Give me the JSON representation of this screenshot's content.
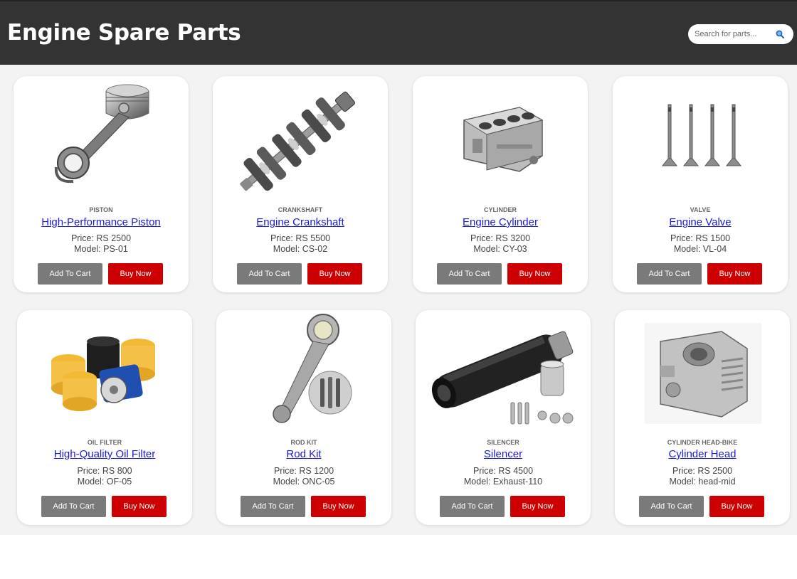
{
  "header": {
    "title": "Engine Spare Parts",
    "search_placeholder": "Search for parts..."
  },
  "products": [
    {
      "category": "PISTON",
      "name": "High-Performance Piston",
      "price": "Price: RS 2500",
      "model": "Model: PS-01",
      "add_label": "Add To Cart",
      "buy_label": "Buy Now",
      "icon": "piston-image"
    },
    {
      "category": "CRANKSHAFT",
      "name": "Engine Crankshaft",
      "price": "Price: RS 5500",
      "model": "Model: CS-02",
      "add_label": "Add To Cart",
      "buy_label": "Buy Now",
      "icon": "crankshaft-image"
    },
    {
      "category": "CYLINDER",
      "name": "Engine Cylinder",
      "price": "Price: RS 3200",
      "model": "Model: CY-03",
      "add_label": "Add To Cart",
      "buy_label": "Buy Now",
      "icon": "cylinder-image"
    },
    {
      "category": "VALVE",
      "name": "Engine Valve",
      "price": "Price: RS 1500",
      "model": "Model: VL-04",
      "add_label": "Add To Cart",
      "buy_label": "Buy Now",
      "icon": "valve-image"
    },
    {
      "category": "OIL FILTER",
      "name": "High-Quality Oil Filter",
      "price": "Price: RS 800",
      "model": "Model: OF-05",
      "add_label": "Add To Cart",
      "buy_label": "Buy Now",
      "icon": "oil-filter-image"
    },
    {
      "category": "ROD KIT",
      "name": "Rod Kit",
      "price": "Price: RS 1200",
      "model": "Model: ONC-05",
      "add_label": "Add To Cart",
      "buy_label": "Buy Now",
      "icon": "rod-kit-image"
    },
    {
      "category": "SILENCER",
      "name": "Silencer",
      "price": "Price: RS 4500",
      "model": "Model: Exhaust-110",
      "add_label": "Add To Cart",
      "buy_label": "Buy Now",
      "icon": "silencer-image"
    },
    {
      "category": "CYLINDER HEAD-BIKE",
      "name": "Cylinder Head",
      "price": "Price: RS 2500",
      "model": "Model: head-mid",
      "add_label": "Add To Cart",
      "buy_label": "Buy Now",
      "icon": "cylinder-head-image"
    }
  ],
  "colors": {
    "header_bg": "#333333",
    "add_to_cart": "#7a7a7a",
    "buy_now": "#cc0000",
    "link": "#1a1adb"
  }
}
